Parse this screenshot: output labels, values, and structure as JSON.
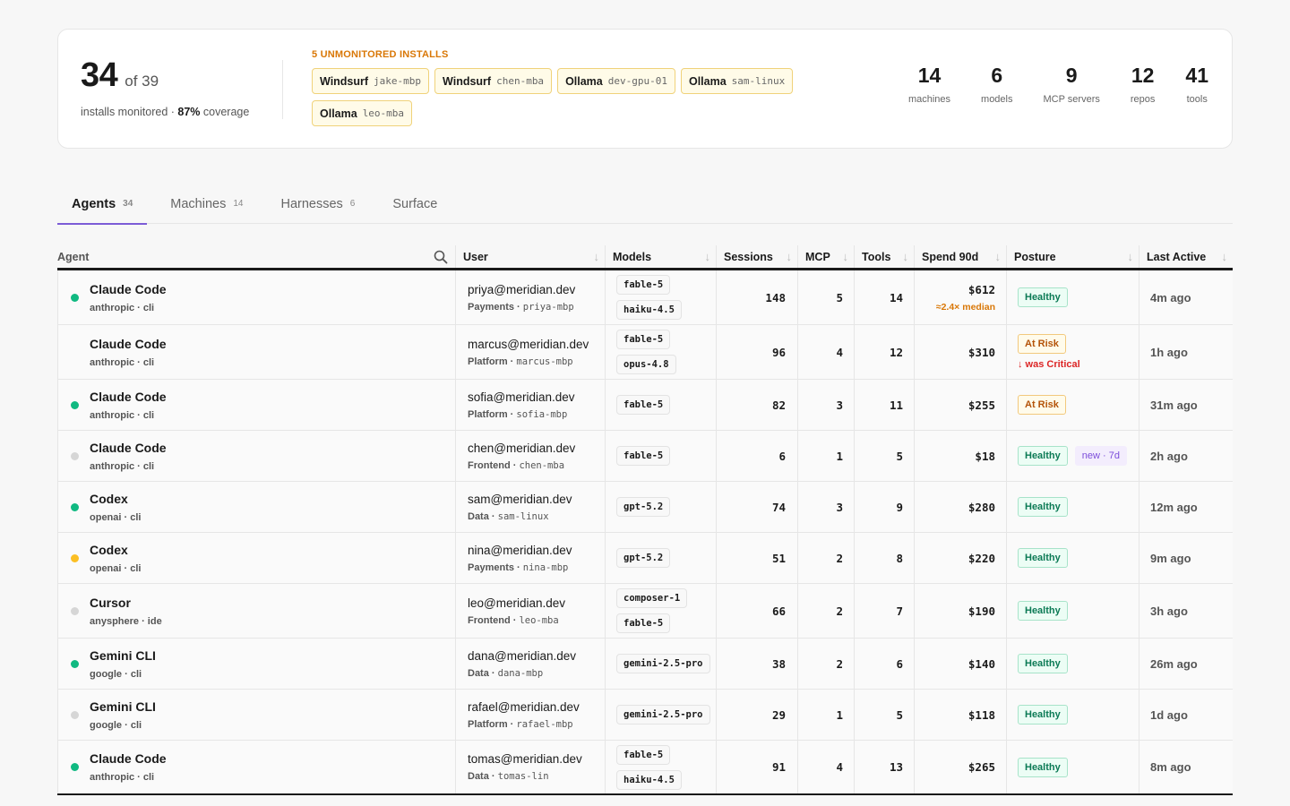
{
  "summary": {
    "monitored": "34",
    "total": "of 39",
    "sub_prefix": "installs monitored · ",
    "coverage": "87%",
    "sub_suffix": " coverage",
    "unmonitored_title": "5 UNMONITORED INSTALLS",
    "unmonitored": [
      {
        "name": "Windsurf",
        "host": "jake-mbp"
      },
      {
        "name": "Windsurf",
        "host": "chen-mba"
      },
      {
        "name": "Ollama",
        "host": "dev-gpu-01"
      },
      {
        "name": "Ollama",
        "host": "sam-linux"
      },
      {
        "name": "Ollama",
        "host": "leo-mba"
      }
    ],
    "stats": [
      {
        "num": "14",
        "label": "machines"
      },
      {
        "num": "6",
        "label": "models"
      },
      {
        "num": "9",
        "label": "MCP servers"
      },
      {
        "num": "12",
        "label": "repos"
      },
      {
        "num": "41",
        "label": "tools"
      }
    ]
  },
  "tabs": [
    {
      "label": "Agents",
      "count": "34"
    },
    {
      "label": "Machines",
      "count": "14"
    },
    {
      "label": "Harnesses",
      "count": "6"
    },
    {
      "label": "Surface",
      "count": ""
    }
  ],
  "columns": {
    "agent": "Agent",
    "user": "User",
    "models": "Models",
    "sessions": "Sessions",
    "mcp": "MCP",
    "tools": "Tools",
    "spend": "Spend 90d",
    "posture": "Posture",
    "last": "Last Active"
  },
  "rows": [
    {
      "status": "green",
      "name": "Claude Code",
      "vendor": "anthropic · cli",
      "email": "priya@meridian.dev",
      "team": "Payments",
      "host": "priya-mbp",
      "models": [
        "fable-5",
        "haiku-4.5"
      ],
      "sessions": "148",
      "mcp": "5",
      "tools": "14",
      "spend": "$612",
      "spend_note": "≈2.4× median",
      "posture": "Healthy",
      "posture_note": "",
      "tag": "",
      "last": "4m ago"
    },
    {
      "status": "none",
      "name": "Claude Code",
      "vendor": "anthropic · cli",
      "email": "marcus@meridian.dev",
      "team": "Platform",
      "host": "marcus-mbp",
      "models": [
        "fable-5",
        "opus-4.8"
      ],
      "sessions": "96",
      "mcp": "4",
      "tools": "12",
      "spend": "$310",
      "spend_note": "",
      "posture": "At Risk",
      "posture_note": "↓ was Critical",
      "tag": "",
      "last": "1h ago"
    },
    {
      "status": "green",
      "name": "Claude Code",
      "vendor": "anthropic · cli",
      "email": "sofia@meridian.dev",
      "team": "Platform",
      "host": "sofia-mbp",
      "models": [
        "fable-5"
      ],
      "sessions": "82",
      "mcp": "3",
      "tools": "11",
      "spend": "$255",
      "spend_note": "",
      "posture": "At Risk",
      "posture_note": "",
      "tag": "",
      "last": "31m ago"
    },
    {
      "status": "gray",
      "name": "Claude Code",
      "vendor": "anthropic · cli",
      "email": "chen@meridian.dev",
      "team": "Frontend",
      "host": "chen-mba",
      "models": [
        "fable-5"
      ],
      "sessions": "6",
      "mcp": "1",
      "tools": "5",
      "spend": "$18",
      "spend_note": "",
      "posture": "Healthy",
      "posture_note": "",
      "tag": "new · 7d",
      "last": "2h ago"
    },
    {
      "status": "green",
      "name": "Codex",
      "vendor": "openai · cli",
      "email": "sam@meridian.dev",
      "team": "Data",
      "host": "sam-linux",
      "models": [
        "gpt-5.2"
      ],
      "sessions": "74",
      "mcp": "3",
      "tools": "9",
      "spend": "$280",
      "spend_note": "",
      "posture": "Healthy",
      "posture_note": "",
      "tag": "",
      "last": "12m ago"
    },
    {
      "status": "amber",
      "name": "Codex",
      "vendor": "openai · cli",
      "email": "nina@meridian.dev",
      "team": "Payments",
      "host": "nina-mbp",
      "models": [
        "gpt-5.2"
      ],
      "sessions": "51",
      "mcp": "2",
      "tools": "8",
      "spend": "$220",
      "spend_note": "",
      "posture": "Healthy",
      "posture_note": "",
      "tag": "",
      "last": "9m ago"
    },
    {
      "status": "gray",
      "name": "Cursor",
      "vendor": "anysphere · ide",
      "email": "leo@meridian.dev",
      "team": "Frontend",
      "host": "leo-mba",
      "models": [
        "composer-1",
        "fable-5"
      ],
      "sessions": "66",
      "mcp": "2",
      "tools": "7",
      "spend": "$190",
      "spend_note": "",
      "posture": "Healthy",
      "posture_note": "",
      "tag": "",
      "last": "3h ago"
    },
    {
      "status": "green",
      "name": "Gemini CLI",
      "vendor": "google · cli",
      "email": "dana@meridian.dev",
      "team": "Data",
      "host": "dana-mbp",
      "models": [
        "gemini-2.5-pro"
      ],
      "sessions": "38",
      "mcp": "2",
      "tools": "6",
      "spend": "$140",
      "spend_note": "",
      "posture": "Healthy",
      "posture_note": "",
      "tag": "",
      "last": "26m ago"
    },
    {
      "status": "gray",
      "name": "Gemini CLI",
      "vendor": "google · cli",
      "email": "rafael@meridian.dev",
      "team": "Platform",
      "host": "rafael-mbp",
      "models": [
        "gemini-2.5-pro"
      ],
      "sessions": "29",
      "mcp": "1",
      "tools": "5",
      "spend": "$118",
      "spend_note": "",
      "posture": "Healthy",
      "posture_note": "",
      "tag": "",
      "last": "1d ago"
    },
    {
      "status": "green",
      "name": "Claude Code",
      "vendor": "anthropic · cli",
      "email": "tomas@meridian.dev",
      "team": "Data",
      "host": "tomas-lin",
      "models": [
        "fable-5",
        "haiku-4.5"
      ],
      "sessions": "91",
      "mcp": "4",
      "tools": "13",
      "spend": "$265",
      "spend_note": "",
      "posture": "Healthy",
      "posture_note": "",
      "tag": "",
      "last": "8m ago"
    }
  ]
}
